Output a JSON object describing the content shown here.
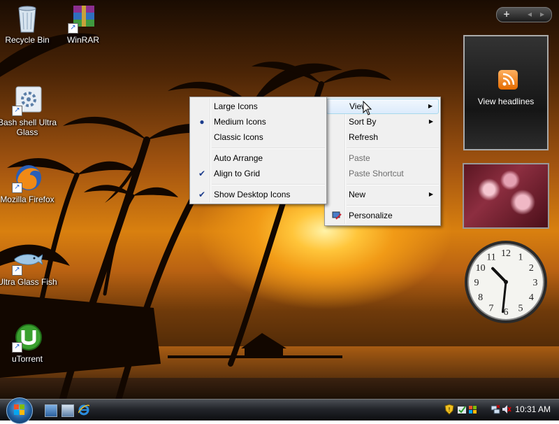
{
  "desktop_icons": [
    {
      "label": "Recycle Bin",
      "icon": "recycle-bin-icon"
    },
    {
      "label": "WinRAR",
      "icon": "winrar-icon"
    },
    {
      "label": "Bash shell Ultra Glass",
      "icon": "bash-shell-icon"
    },
    {
      "label": "Mozilla Firefox",
      "icon": "firefox-icon"
    },
    {
      "label": "Ultra Glass Fish",
      "icon": "fish-icon"
    },
    {
      "label": "uTorrent",
      "icon": "utorrent-icon"
    }
  ],
  "context_menu": {
    "items": [
      {
        "label": "View",
        "state": "hover",
        "submenu": true
      },
      {
        "label": "Sort By",
        "submenu": true
      },
      {
        "label": "Refresh"
      },
      {
        "label": "Paste",
        "disabled": true
      },
      {
        "label": "Paste Shortcut",
        "disabled": true
      },
      {
        "label": "New",
        "submenu": true
      },
      {
        "label": "Personalize",
        "icon": "personalize-icon"
      }
    ]
  },
  "view_submenu": {
    "items": [
      {
        "label": "Large Icons"
      },
      {
        "label": "Medium Icons",
        "mark": "radio"
      },
      {
        "label": "Classic Icons"
      },
      {
        "label": "Auto Arrange"
      },
      {
        "label": "Align to Grid",
        "mark": "check"
      },
      {
        "label": "Show Desktop Icons",
        "mark": "check"
      }
    ]
  },
  "sidebar": {
    "controls": {
      "add": "+",
      "prev": "◂",
      "next": "▸"
    },
    "feed_gadget": {
      "label": "View headlines"
    },
    "clock": {
      "hour": 10,
      "minute": 31
    }
  },
  "taskbar": {
    "clock": "10:31 AM"
  },
  "colors": {
    "menu_background": "#f0f0f0",
    "menu_hover": "#dcebfc",
    "taskbar": "#23262b"
  }
}
